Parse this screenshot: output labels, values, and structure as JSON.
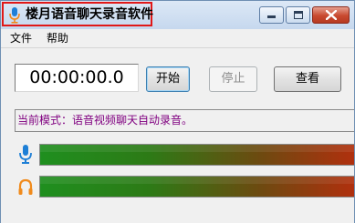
{
  "window": {
    "title": "楼月语音聊天录音软件",
    "controls": {
      "minimize": "minimize-icon",
      "maximize": "maximize-icon",
      "close": "close-icon"
    }
  },
  "menu": {
    "file": "文件",
    "help": "帮助"
  },
  "recorder": {
    "timer": "00:00:00.0",
    "start_label": "开始",
    "stop_label": "停止",
    "view_label": "查看"
  },
  "status": {
    "mode_text": "当前模式：语音视频聊天自动录音。"
  },
  "meters": {
    "microphone_icon": "microphone-icon",
    "speaker_icon": "headphones-icon"
  },
  "colors": {
    "title_highlight": "#e01818",
    "mode_text": "#800080",
    "icon_blue": "#1e7fd6",
    "icon_orange": "#f08a1c"
  }
}
